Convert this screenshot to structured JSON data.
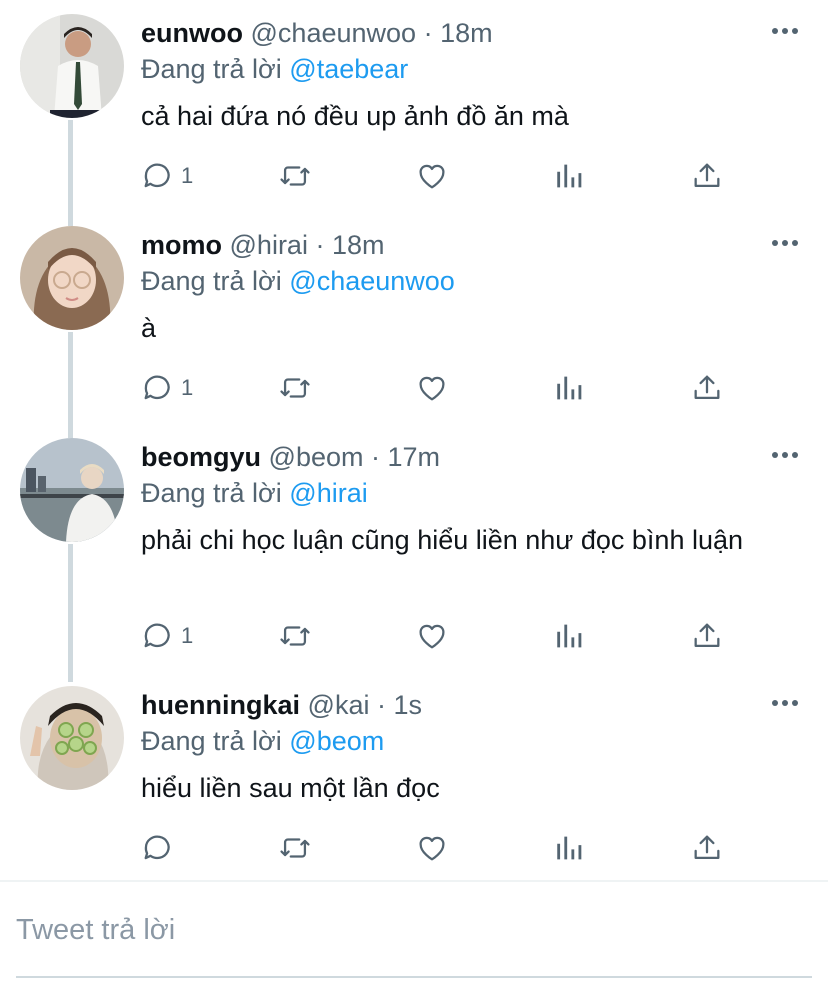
{
  "tweets": [
    {
      "name": "eunwoo",
      "handle": "@chaeunwoo",
      "time": "18m",
      "reply_prefix": "Đang trả lời",
      "reply_to": "@taebear",
      "text": "cả hai đứa nó đều up ảnh đồ ăn mà",
      "reply_count": "1",
      "avatar_icon": "avatar-man-white-shirt"
    },
    {
      "name": "momo",
      "handle": "@hirai",
      "time": "18m",
      "reply_prefix": "Đang trả lời",
      "reply_to": "@chaeunwoo",
      "text": "à",
      "reply_count": "1",
      "avatar_icon": "avatar-woman-glasses"
    },
    {
      "name": "beomgyu",
      "handle": "@beom",
      "time": "17m",
      "reply_prefix": "Đang trả lời",
      "reply_to": "@hirai",
      "text": "phải chi học luận cũng hiểu liền như đọc bình luận",
      "reply_count": "1",
      "avatar_icon": "avatar-man-waterfront"
    },
    {
      "name": "huenningkai",
      "handle": "@kai",
      "time": "1s",
      "reply_prefix": "Đang trả lời",
      "reply_to": "@beom",
      "text": "hiểu liền sau một lần đọc",
      "reply_count": "",
      "avatar_icon": "avatar-cucumber-mask"
    }
  ],
  "separator": "·",
  "compose": {
    "placeholder": "Tweet trả lời"
  },
  "colors": {
    "accent": "#1d9bf0",
    "secondary_text": "#536471",
    "thread_line": "#cfd9de"
  }
}
